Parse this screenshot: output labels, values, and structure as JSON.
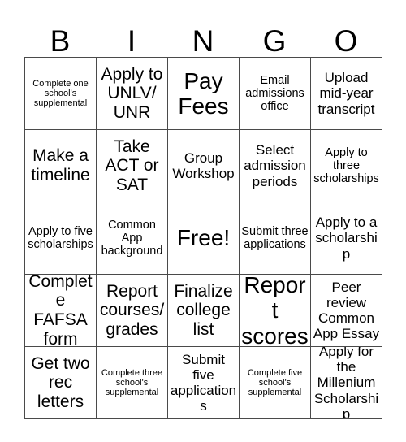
{
  "card": {
    "title": "BINGO",
    "header_letters": [
      "B",
      "I",
      "N",
      "G",
      "O"
    ],
    "free_space_label": "Free!",
    "cells": [
      {
        "text": "Complete one school's supplemental",
        "size": "s-xs"
      },
      {
        "text": "Apply to UNLV/ UNR",
        "size": "s-lg"
      },
      {
        "text": "Pay Fees",
        "size": "s-xl"
      },
      {
        "text": "Email admissions office",
        "size": "s-sm"
      },
      {
        "text": "Upload mid-year transcript",
        "size": "s-md"
      },
      {
        "text": "Make a timeline",
        "size": "s-lg"
      },
      {
        "text": "Take ACT or SAT",
        "size": "s-lg"
      },
      {
        "text": "Group Workshop",
        "size": "s-md"
      },
      {
        "text": "Select admission periods",
        "size": "s-md"
      },
      {
        "text": "Apply to three scholarships",
        "size": "s-sm"
      },
      {
        "text": "Apply to five scholarships",
        "size": "s-sm"
      },
      {
        "text": "Common App background",
        "size": "s-sm"
      },
      {
        "text": "Free!",
        "size": "s-xl"
      },
      {
        "text": "Submit three applications",
        "size": "s-sm"
      },
      {
        "text": "Apply to a scholarship",
        "size": "s-md"
      },
      {
        "text": "Complete FAFSA form",
        "size": "s-lg"
      },
      {
        "text": "Report courses/ grades",
        "size": "s-lg"
      },
      {
        "text": "Finalize college list",
        "size": "s-lg"
      },
      {
        "text": "Report scores",
        "size": "s-xl"
      },
      {
        "text": "Peer review Common App Essay",
        "size": "s-md"
      },
      {
        "text": "Get two rec letters",
        "size": "s-lg"
      },
      {
        "text": "Complete three school's supplemental",
        "size": "s-xs"
      },
      {
        "text": "Submit five applications",
        "size": "s-md"
      },
      {
        "text": "Complete five school's supplemental",
        "size": "s-xs"
      },
      {
        "text": "Apply for the Millenium Scholarship",
        "size": "s-md"
      }
    ]
  },
  "colors": {
    "background": "#ffffff",
    "text": "#000000",
    "border": "#4a4a4a"
  }
}
